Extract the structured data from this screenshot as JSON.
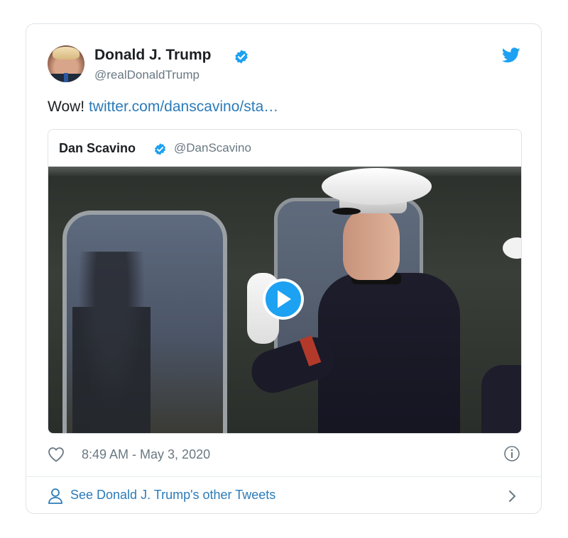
{
  "tweet": {
    "author_name": "Donald J. Trump",
    "author_handle": "@realDonaldTrump",
    "text_prefix": "Wow!",
    "link_text": "twitter.com/danscavino/sta…",
    "timestamp": "8:49 AM - May 3, 2020"
  },
  "quoted_tweet": {
    "author_name": "Dan Scavino",
    "author_handle": "@DanScavino"
  },
  "footer": {
    "label": "See Donald J. Trump's other Tweets"
  },
  "icons": {
    "verified": "verified-badge-icon",
    "brand": "twitter-bird-icon",
    "play": "play-icon",
    "like": "heart-icon",
    "info": "info-icon",
    "profile": "person-icon",
    "next": "chevron-right-icon"
  },
  "colors": {
    "accent": "#1da1f2",
    "link": "#2b7bb9",
    "secondary_text": "#697882",
    "border": "#dfe3e6"
  }
}
